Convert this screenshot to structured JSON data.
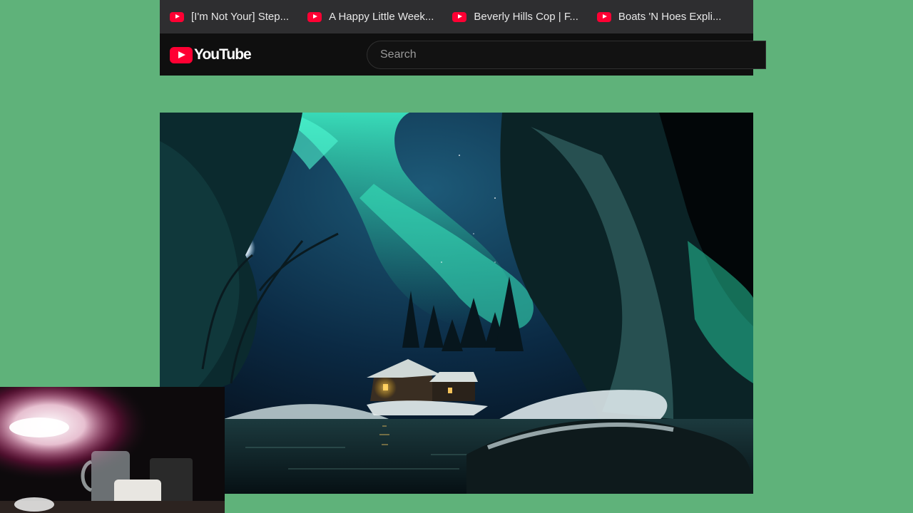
{
  "bookmarks": [
    {
      "label": "[I'm Not Your] Step...",
      "icon": "youtube-favicon-icon"
    },
    {
      "label": "A Happy Little Week...",
      "icon": "youtube-favicon-icon"
    },
    {
      "label": "Beverly Hills Cop | F...",
      "icon": "youtube-favicon-icon"
    },
    {
      "label": "Boats 'N Hoes Expli...",
      "icon": "youtube-favicon-icon"
    }
  ],
  "header": {
    "logo_text": "YouTube",
    "search": {
      "placeholder": "Search",
      "value": ""
    }
  },
  "colors": {
    "page_background": "#5fb27a",
    "bookmarks_bar": "#2e2e30",
    "header_background": "#0f0f0f",
    "brand_red": "#ff0033",
    "aurora": "#2de0b0"
  }
}
